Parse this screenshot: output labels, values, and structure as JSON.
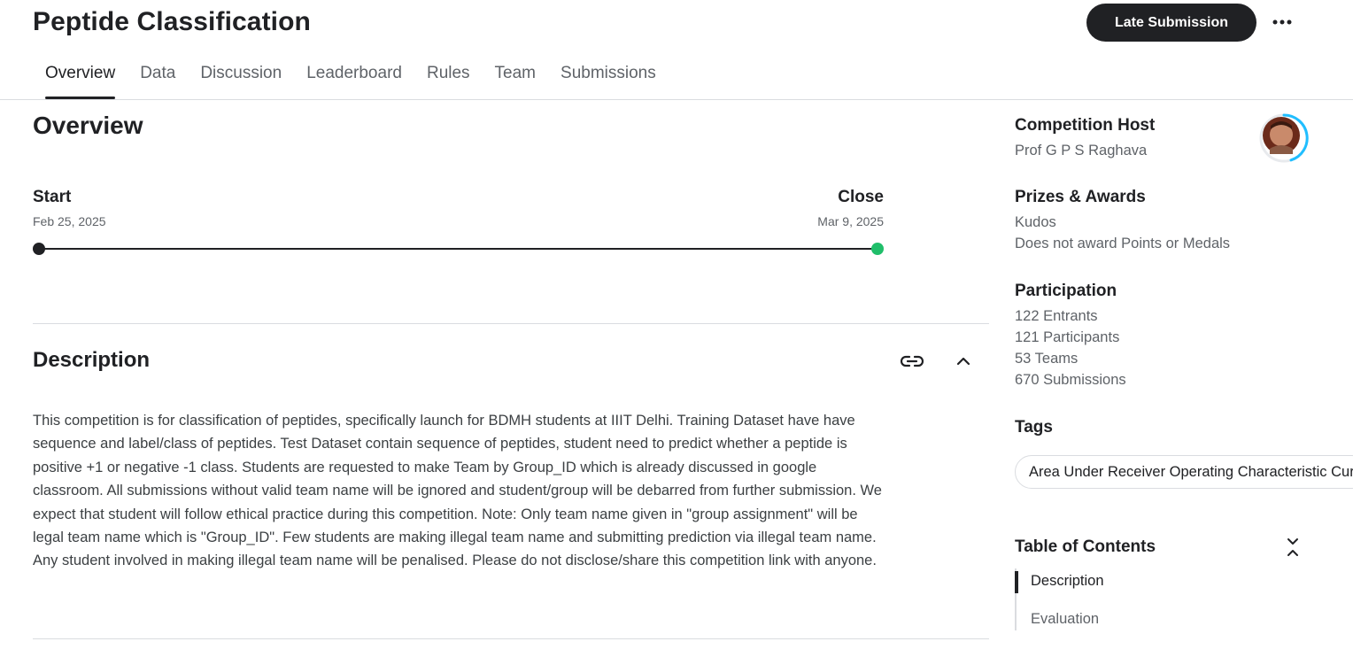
{
  "header": {
    "title": "Peptide Classification",
    "late_submission_label": "Late Submission",
    "more_icon": "more-horizontal-icon"
  },
  "tabs": [
    {
      "label": "Overview",
      "active": true
    },
    {
      "label": "Data"
    },
    {
      "label": "Discussion"
    },
    {
      "label": "Leaderboard"
    },
    {
      "label": "Rules"
    },
    {
      "label": "Team"
    },
    {
      "label": "Submissions"
    }
  ],
  "overview": {
    "heading": "Overview",
    "timeline": {
      "start_label": "Start",
      "start_date": "Feb 25, 2025",
      "close_label": "Close",
      "close_date": "Mar 9, 2025",
      "start_color": "#202124",
      "close_color": "#20be6a"
    }
  },
  "description": {
    "heading": "Description",
    "link_icon": "link-icon",
    "collapse_icon": "chevron-up-icon",
    "body": "This competition is for classification of peptides, specifically launch for BDMH students at IIIT Delhi. Training Dataset have have sequence and label/class of peptides. Test Dataset contain sequence of peptides, student need to predict whether a peptide is positive +1 or negative -1 class. Students are requested to make Team by Group_ID which is already discussed in google classroom. All submissions without valid team name will be ignored and student/group will be debarred from further submission. We expect that student will follow ethical practice during this competition. Note: Only team name given in \"group assignment\" will be legal team name which is \"Group_ID\". Few students are making illegal team name and submitting prediction via illegal team name. Any student involved in making illegal team name will be penalised. Please do not disclose/share this competition link with anyone."
  },
  "sidebar": {
    "host_heading": "Competition Host",
    "host_name": "Prof G P S Raghava",
    "prizes_heading": "Prizes & Awards",
    "prize": "Kudos",
    "prize_note": "Does not award Points or Medals",
    "participation_heading": "Participation",
    "entrants": "122 Entrants",
    "participants": "121 Participants",
    "teams": "53 Teams",
    "submissions": "670 Submissions",
    "tags_heading": "Tags",
    "tag": "Area Under Receiver Operating Characteristic Curve",
    "toc_heading": "Table of Contents",
    "toc_toggle_icon": "collapse-vertical-icon",
    "toc": [
      "Description",
      "Evaluation"
    ],
    "accent_color": "#20beff"
  }
}
